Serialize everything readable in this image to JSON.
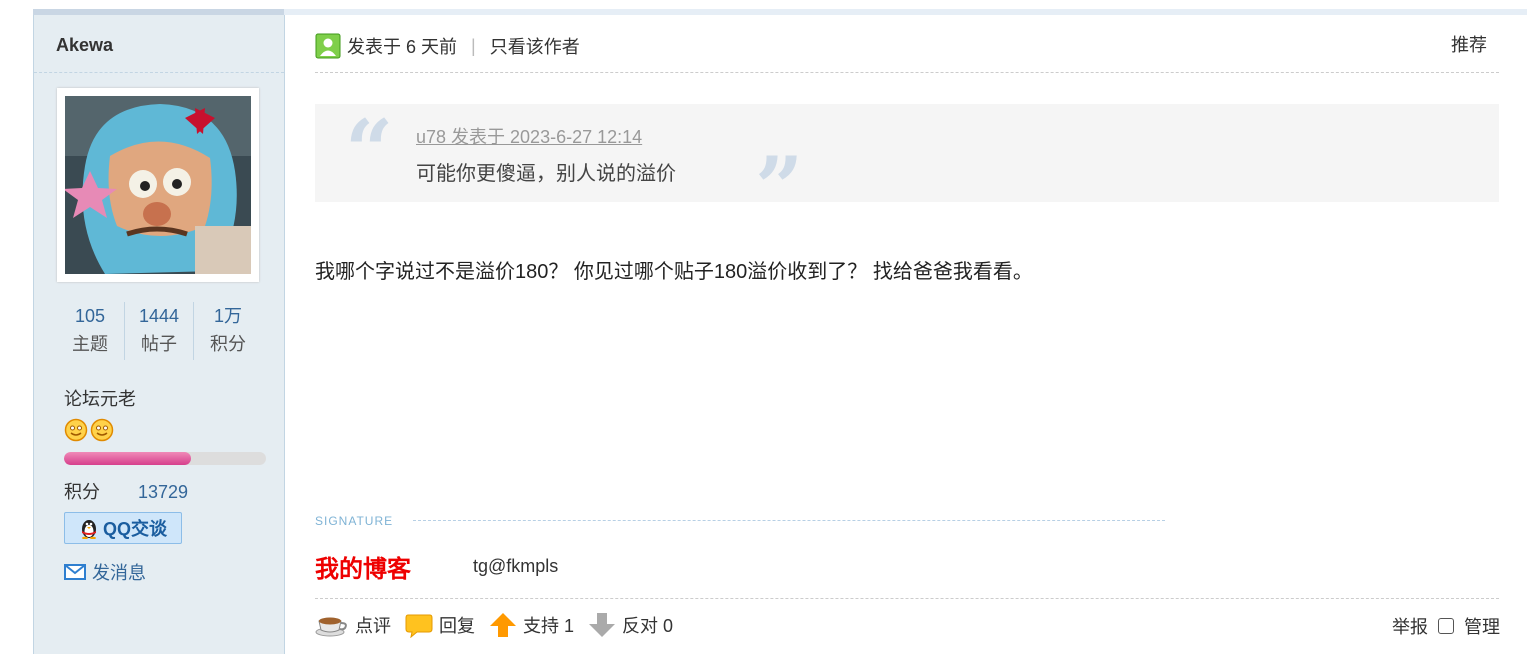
{
  "author": {
    "username": "Akewa",
    "stats": [
      {
        "value": "105",
        "label": "主题"
      },
      {
        "value": "1444",
        "label": "帖子"
      },
      {
        "value": "1万",
        "label": "积分"
      }
    ],
    "rank": "论坛元老",
    "rank_progress": 0.63,
    "credits_label": "积分",
    "credits_value": "13729",
    "qq_button": "QQ交谈",
    "message_link": "发消息"
  },
  "post": {
    "posted": "发表于 6 天前",
    "author_only": "只看该作者",
    "recommend": "推荐",
    "quote": {
      "header": "u78 发表于 2023-6-27 12:14",
      "text": "可能你更傻逼，别人说的溢价"
    },
    "body": "我哪个字说过不是溢价180？ 你见过哪个贴子180溢价收到了？ 找给爸爸我看看。",
    "signature": {
      "title": "SIGNATURE",
      "blog": "我的博客",
      "contact": "tg@fkmpls"
    }
  },
  "actions": {
    "comment": "点评",
    "reply": "回复",
    "support": "支持 1",
    "oppose": "反对 0",
    "report": "举报",
    "manage": "管理"
  }
}
